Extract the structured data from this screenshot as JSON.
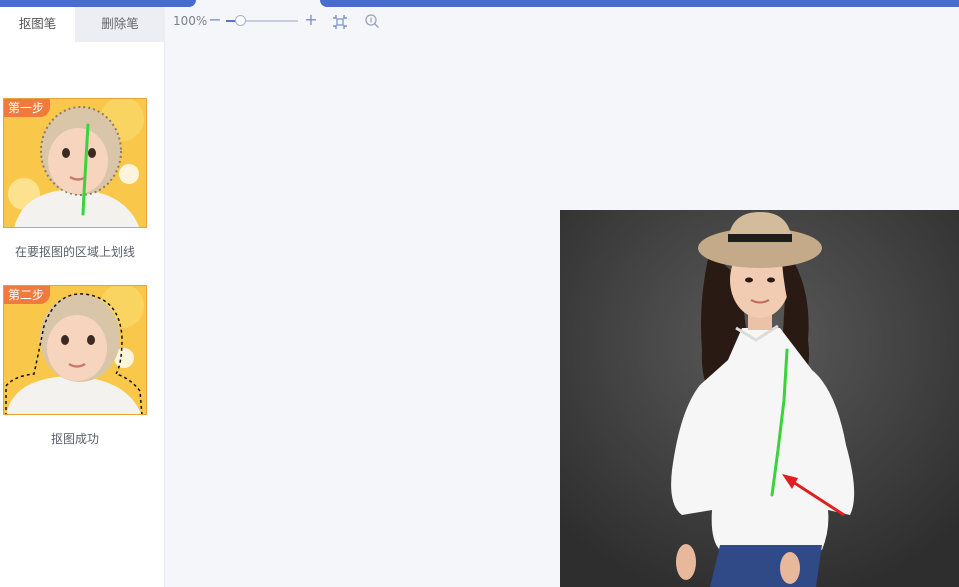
{
  "tabs": {
    "cutout_label": "抠图笔",
    "erase_label": "删除笔"
  },
  "steps": [
    {
      "badge": "第一步",
      "caption": "在要抠图的区域上划线"
    },
    {
      "badge": "第二步",
      "caption": "抠图成功"
    }
  ],
  "toolbar": {
    "zoom_value": "100%",
    "zoom_minus": "−",
    "zoom_plus": "+",
    "zoom_level": 0.2
  },
  "colors": {
    "accent": "#4a6bd0",
    "stroke_green": "#3ad43a",
    "arrow_red": "#e02020",
    "badge_orange": "#f07a3a",
    "step_bg": "#f9c84a"
  },
  "icons": {
    "fit": "fit-to-screen-icon",
    "zoom": "zoom-in-icon"
  }
}
